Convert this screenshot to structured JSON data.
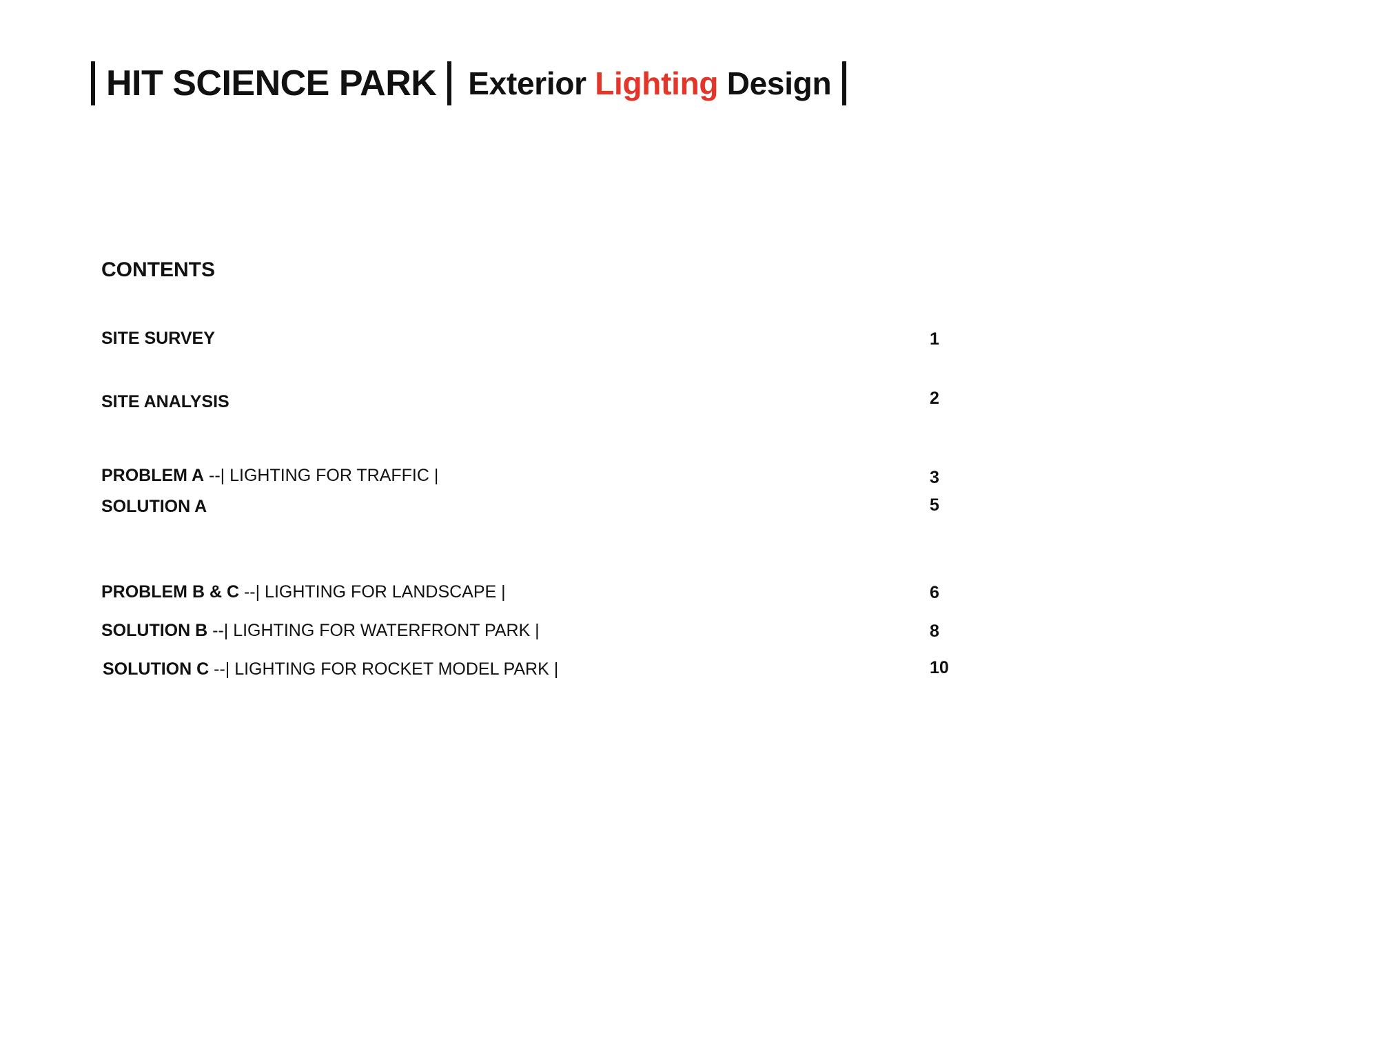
{
  "header": {
    "park_title": "HIT SCIENCE PARK",
    "subtitle_pre": "Exterior",
    "subtitle_accent": "Lighting",
    "subtitle_post": "Design",
    "accent_color": "#e2362b"
  },
  "contents": {
    "heading": "CONTENTS",
    "entries": [
      {
        "title": "SITE SURVEY",
        "detail": "",
        "page": "1"
      },
      {
        "title": "SITE ANALYSIS",
        "detail": "",
        "page": "2"
      },
      {
        "title": "PROBLEM A",
        "detail": " --| LIGHTING FOR TRAFFIC |",
        "page": "3"
      },
      {
        "title": "SOLUTION A",
        "detail": "",
        "page": "5"
      },
      {
        "title": "PROBLEM B & C",
        "detail": " --| LIGHTING FOR LANDSCAPE |",
        "page": "6"
      },
      {
        "title": "SOLUTION B",
        "detail": " --| LIGHTING FOR WATERFRONT PARK |",
        "page": "8"
      },
      {
        "title": "SOLUTION C",
        "detail": " --| LIGHTING FOR ROCKET MODEL PARK |",
        "page": "10"
      }
    ]
  }
}
